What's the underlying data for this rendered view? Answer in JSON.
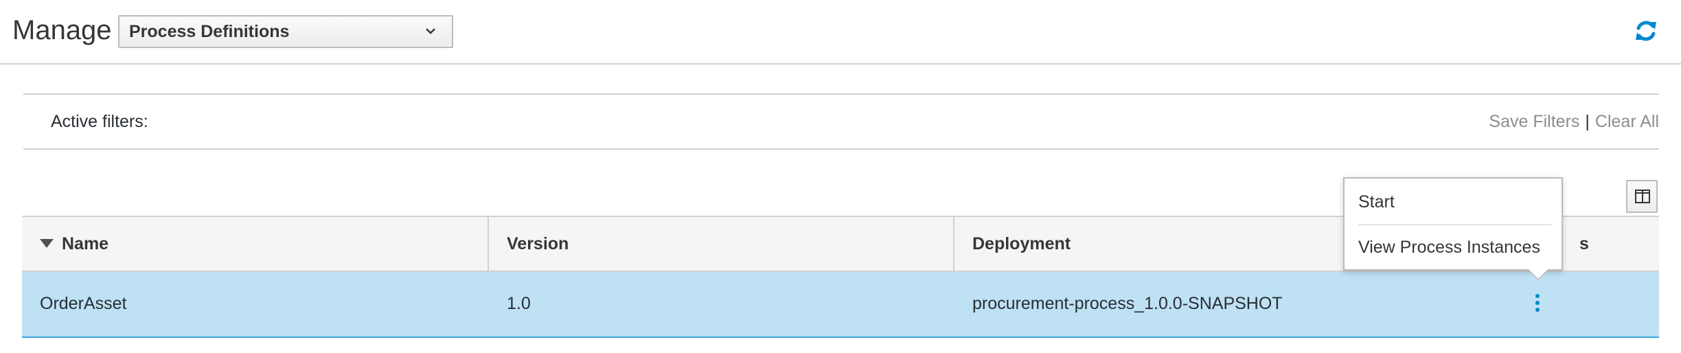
{
  "header": {
    "title": "Manage",
    "selector": {
      "selected": "Process Definitions"
    }
  },
  "filters": {
    "label": "Active filters:",
    "save": "Save Filters",
    "separator": "|",
    "clear": "Clear All"
  },
  "table": {
    "columns": [
      "Name",
      "Version",
      "Deployment",
      "Actions"
    ],
    "visible_column_headers": [
      "Name",
      "Version",
      "Deployment",
      "s"
    ],
    "rows": [
      {
        "name": "OrderAsset",
        "version": "1.0",
        "deployment": "procurement-process_1.0.0-SNAPSHOT"
      }
    ]
  },
  "menu": {
    "items": [
      "Start",
      "View Process Instances"
    ]
  },
  "colors": {
    "accent": "#0088ce",
    "selected_row": "#bee1f4",
    "header_bg": "#f5f5f5",
    "link_gray": "#8b8d8f"
  },
  "icons": {
    "refresh": "refresh-icon",
    "dropdown": "chevron-down-icon",
    "columns": "columns-icon",
    "kebab": "kebab-icon",
    "sort": "sort-desc-icon"
  }
}
